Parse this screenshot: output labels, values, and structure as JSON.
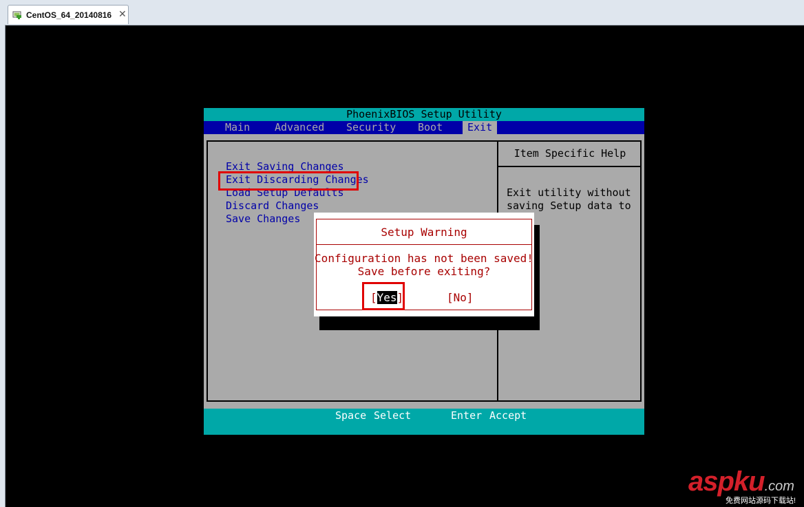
{
  "window": {
    "tab_title": "CentOS_64_20140816",
    "tab_icon": "vm-icon",
    "close_glyph": "✕"
  },
  "bios": {
    "title": "PhoenixBIOS Setup Utility",
    "menu": [
      "Main",
      "Advanced",
      "Security",
      "Boot",
      "Exit"
    ],
    "active_menu": "Exit",
    "exit_options": [
      "Exit Saving Changes",
      "Exit Discarding Changes",
      "Load Setup Defaults",
      "Discard Changes",
      "Save Changes"
    ],
    "highlighted_option": "Exit Discarding Changes",
    "help": {
      "title": "Item Specific Help",
      "lines": [
        "Exit utility without",
        "saving Setup data to"
      ]
    },
    "footer": {
      "space_key": "Space",
      "space_action": "Select",
      "enter_key": "Enter",
      "enter_action": "Accept"
    },
    "colors": {
      "title_bar": "#00a8a8",
      "menu_bar": "#0000a8",
      "body": "#aaaaaa",
      "dialog_text": "#a80000",
      "highlight_box": "#e00000"
    }
  },
  "dialog": {
    "title": "Setup Warning",
    "line1": "Configuration has not been saved!",
    "line2": "Save before exiting?",
    "yes_open": "[",
    "yes_label": "Yes",
    "yes_close": "]",
    "no_label": "[No]",
    "selected": "Yes"
  },
  "watermark": {
    "main": "aspku",
    "suffix": ".com",
    "sub": "免费网站源码下载站!"
  }
}
